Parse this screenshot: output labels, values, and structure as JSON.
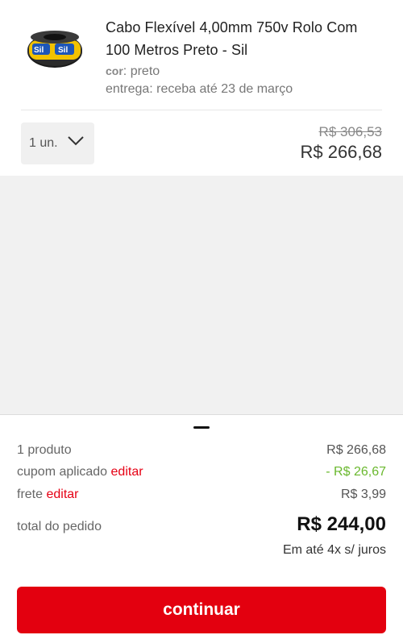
{
  "product": {
    "title": "Cabo Flexível 4,00mm 750v Rolo Com 100 Metros Preto - Sil",
    "color_key": "cor",
    "color_value": ": preto",
    "delivery": "entrega: receba até 23 de março",
    "quantity": "1 un.",
    "price_old": "R$ 306,53",
    "price_new": "R$ 266,68",
    "image_icon": "cable-roll-icon"
  },
  "summary": {
    "products_label": "1 produto",
    "products_value": "R$ 266,68",
    "coupon_label": "cupom aplicado",
    "coupon_edit": "editar",
    "coupon_value": "- R$ 26,67",
    "shipping_label": "frete",
    "shipping_edit": "editar",
    "shipping_value": "R$ 3,99",
    "total_label": "total do pedido",
    "total_value": "R$ 244,00",
    "installments": "Em até 4x s/ juros",
    "continue_label": "continuar"
  },
  "colors": {
    "accent": "#e3000f",
    "discount": "#6ab82e",
    "background": "#f1f1f1"
  }
}
